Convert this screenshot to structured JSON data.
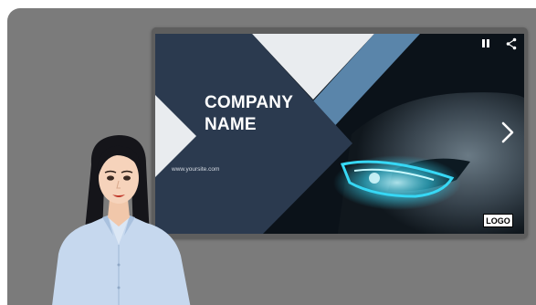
{
  "slide": {
    "company_name": "COMPANY\nNAME",
    "website": "www.yoursite.com",
    "logo_label": "LOGO"
  },
  "controls": {
    "pause_icon": "pause-icon",
    "share_icon": "share-icon",
    "next_icon": "chevron-right-icon"
  },
  "colors": {
    "stage_bg": "#7b7b7b",
    "frame": "#5e5e5e",
    "slide_navy": "#2b3a4f",
    "slide_blue_stripe": "#5a85aa",
    "headlight_glow": "#37d8f5"
  }
}
